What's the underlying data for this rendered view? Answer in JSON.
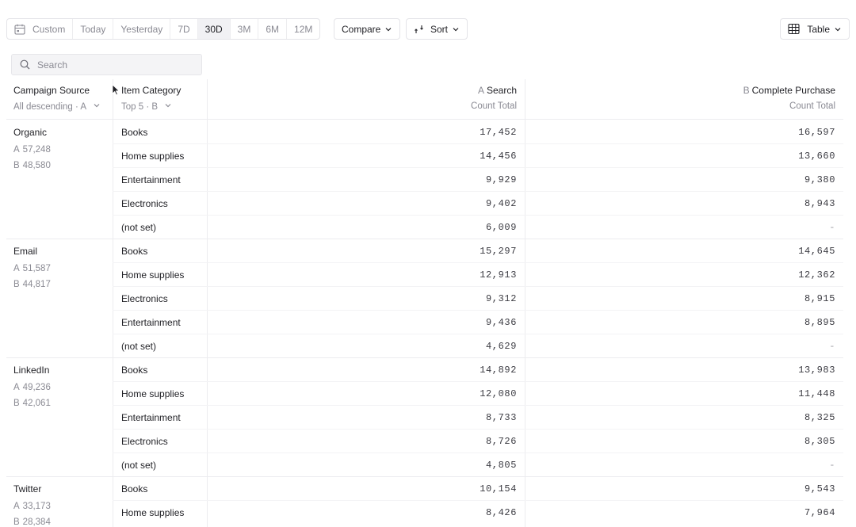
{
  "toolbar": {
    "range_buttons": [
      "Custom",
      "Today",
      "Yesterday",
      "7D",
      "30D",
      "3M",
      "6M",
      "12M"
    ],
    "active_range": "30D",
    "compare_label": "Compare",
    "sort_label": "Sort",
    "view_label": "Table"
  },
  "search": {
    "placeholder": "Search"
  },
  "table": {
    "col_source": {
      "title": "Campaign Source",
      "sub": "All descending · A"
    },
    "col_category": {
      "title": "Item Category",
      "sub": "Top 5 · B"
    },
    "col_a": {
      "letter": "A",
      "title": "Search",
      "sub": "Count Total"
    },
    "col_b": {
      "letter": "B",
      "title": "Complete Purchase",
      "sub": "Count Total"
    },
    "groups": [
      {
        "name": "Organic",
        "a_label": "A",
        "a_total": "57,248",
        "b_label": "B",
        "b_total": "48,580",
        "rows": [
          {
            "cat": "Books",
            "a": "17,452",
            "b": "16,597"
          },
          {
            "cat": "Home supplies",
            "a": "14,456",
            "b": "13,660"
          },
          {
            "cat": "Entertainment",
            "a": "9,929",
            "b": "9,380"
          },
          {
            "cat": "Electronics",
            "a": "9,402",
            "b": "8,943"
          },
          {
            "cat": "(not set)",
            "a": "6,009",
            "b": "-"
          }
        ]
      },
      {
        "name": "Email",
        "a_label": "A",
        "a_total": "51,587",
        "b_label": "B",
        "b_total": "44,817",
        "rows": [
          {
            "cat": "Books",
            "a": "15,297",
            "b": "14,645"
          },
          {
            "cat": "Home supplies",
            "a": "12,913",
            "b": "12,362"
          },
          {
            "cat": "Electronics",
            "a": "9,312",
            "b": "8,915"
          },
          {
            "cat": "Entertainment",
            "a": "9,436",
            "b": "8,895"
          },
          {
            "cat": "(not set)",
            "a": "4,629",
            "b": "-"
          }
        ]
      },
      {
        "name": "LinkedIn",
        "a_label": "A",
        "a_total": "49,236",
        "b_label": "B",
        "b_total": "42,061",
        "rows": [
          {
            "cat": "Books",
            "a": "14,892",
            "b": "13,983"
          },
          {
            "cat": "Home supplies",
            "a": "12,080",
            "b": "11,448"
          },
          {
            "cat": "Entertainment",
            "a": "8,733",
            "b": "8,325"
          },
          {
            "cat": "Electronics",
            "a": "8,726",
            "b": "8,305"
          },
          {
            "cat": "(not set)",
            "a": "4,805",
            "b": "-"
          }
        ]
      },
      {
        "name": "Twitter",
        "a_label": "A",
        "a_total": "33,173",
        "b_label": "B",
        "b_total": "28,384",
        "rows": [
          {
            "cat": "Books",
            "a": "10,154",
            "b": "9,543"
          },
          {
            "cat": "Home supplies",
            "a": "8,426",
            "b": "7,964"
          }
        ]
      }
    ]
  },
  "icons": {
    "calendar": "calendar-icon",
    "search": "search-icon",
    "sort": "sort-icon",
    "table": "table-grid-icon",
    "chevron": "chevron-down-icon",
    "cursor": "mouse-cursor-icon"
  }
}
